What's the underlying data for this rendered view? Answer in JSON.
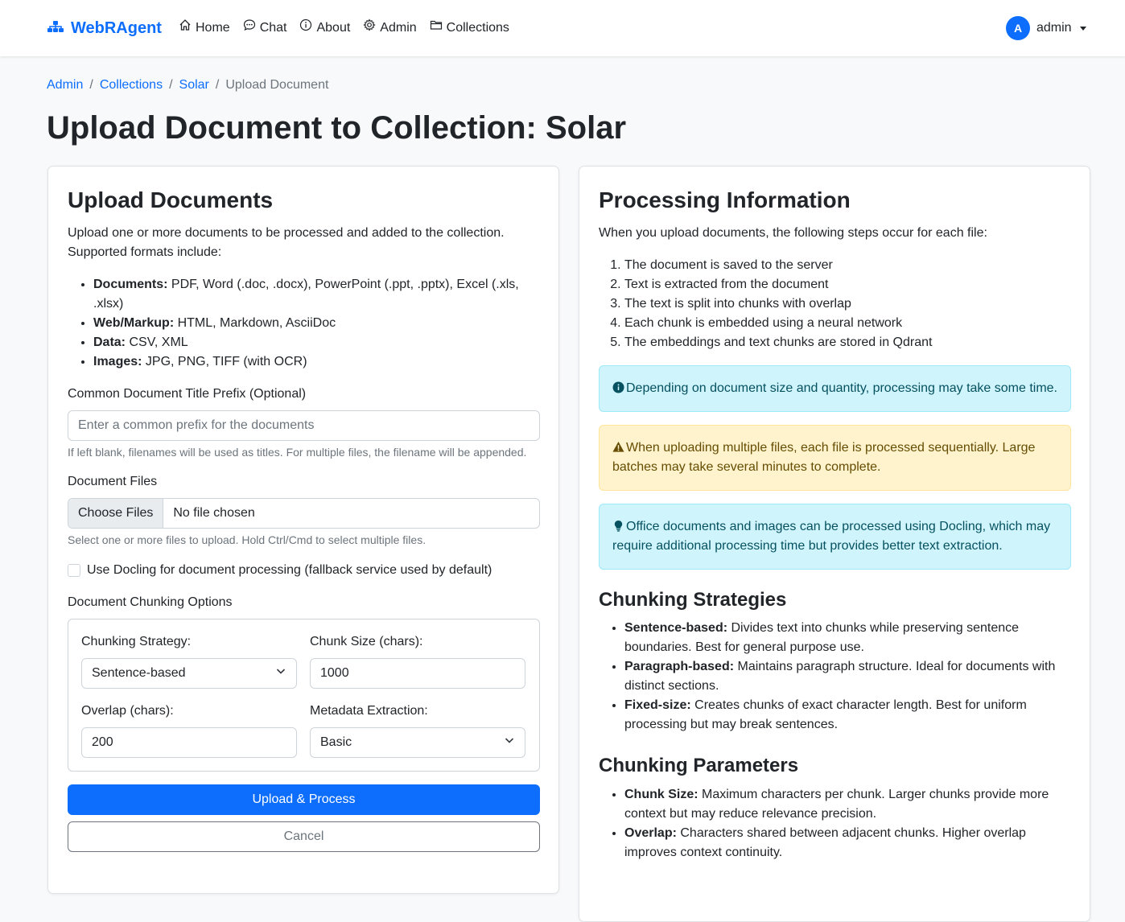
{
  "navbar": {
    "brand": "WebRAgent",
    "links": [
      {
        "label": "Home",
        "icon": "house-icon"
      },
      {
        "label": "Chat",
        "icon": "chat-bubble-icon"
      },
      {
        "label": "About",
        "icon": "info-circle-icon"
      },
      {
        "label": "Admin",
        "icon": "gear-icon"
      },
      {
        "label": "Collections",
        "icon": "folder-icon"
      }
    ],
    "user": {
      "initial": "A",
      "name": "admin"
    }
  },
  "breadcrumb": {
    "items": [
      "Admin",
      "Collections",
      "Solar"
    ],
    "active": "Upload Document",
    "separator": "/"
  },
  "page_title": "Upload Document to Collection: Solar",
  "upload_card": {
    "title": "Upload Documents",
    "intro": "Upload one or more documents to be processed and added to the collection. Supported formats include:",
    "formats": [
      {
        "label": "Documents:",
        "text": " PDF, Word (.doc, .docx), PowerPoint (.ppt, .pptx), Excel (.xls, .xlsx)"
      },
      {
        "label": "Web/Markup:",
        "text": " HTML, Markdown, AsciiDoc"
      },
      {
        "label": "Data:",
        "text": " CSV, XML"
      },
      {
        "label": "Images:",
        "text": " JPG, PNG, TIFF (with OCR)"
      }
    ],
    "prefix_label": "Common Document Title Prefix (Optional)",
    "prefix_placeholder": "Enter a common prefix for the documents",
    "prefix_help": "If left blank, filenames will be used as titles. For multiple files, the filename will be appended.",
    "files_label": "Document Files",
    "choose_files": "Choose Files",
    "no_file": "No file chosen",
    "files_help": "Select one or more files to upload. Hold Ctrl/Cmd to select multiple files.",
    "docling_label": "Use Docling for document processing (fallback service used by default)",
    "docling_checked": false,
    "chunking_title": "Document Chunking Options",
    "strategy_label": "Chunking Strategy:",
    "strategy_value": "Sentence-based",
    "chunk_size_label": "Chunk Size (chars):",
    "chunk_size_value": "1000",
    "overlap_label": "Overlap (chars):",
    "overlap_value": "200",
    "metadata_label": "Metadata Extraction:",
    "metadata_value": "Basic",
    "upload_button": "Upload & Process",
    "cancel_button": "Cancel"
  },
  "info_card": {
    "title": "Processing Information",
    "intro": "When you upload documents, the following steps occur for each file:",
    "steps": [
      "The document is saved to the server",
      "Text is extracted from the document",
      "The text is split into chunks with overlap",
      "Each chunk is embedded using a neural network",
      "The embeddings and text chunks are stored in Qdrant"
    ],
    "alert_time": "Depending on document size and quantity, processing may take some time.",
    "alert_multiple": "When uploading multiple files, each file is processed sequentially. Large batches may take several minutes to complete.",
    "alert_docling": "Office documents and images can be processed using Docling, which may require additional processing time but provides better text extraction.",
    "strategies_title": "Chunking Strategies",
    "strategies": [
      {
        "label": "Sentence-based:",
        "text": " Divides text into chunks while preserving sentence boundaries. Best for general purpose use."
      },
      {
        "label": "Paragraph-based:",
        "text": " Maintains paragraph structure. Ideal for documents with distinct sections."
      },
      {
        "label": "Fixed-size:",
        "text": " Creates chunks of exact character length. Best for uniform processing but may break sentences."
      }
    ],
    "parameters_title": "Chunking Parameters",
    "parameters": [
      {
        "label": "Chunk Size:",
        "text": " Maximum characters per chunk. Larger chunks provide more context but may reduce relevance precision."
      },
      {
        "label": "Overlap:",
        "text": " Characters shared between adjacent chunks. Higher overlap improves context continuity."
      }
    ]
  },
  "colors": {
    "primary": "#0d6efd",
    "info_bg": "#cff4fc",
    "info_text": "#055160",
    "warning_bg": "#fff3cd",
    "warning_text": "#664d03"
  }
}
